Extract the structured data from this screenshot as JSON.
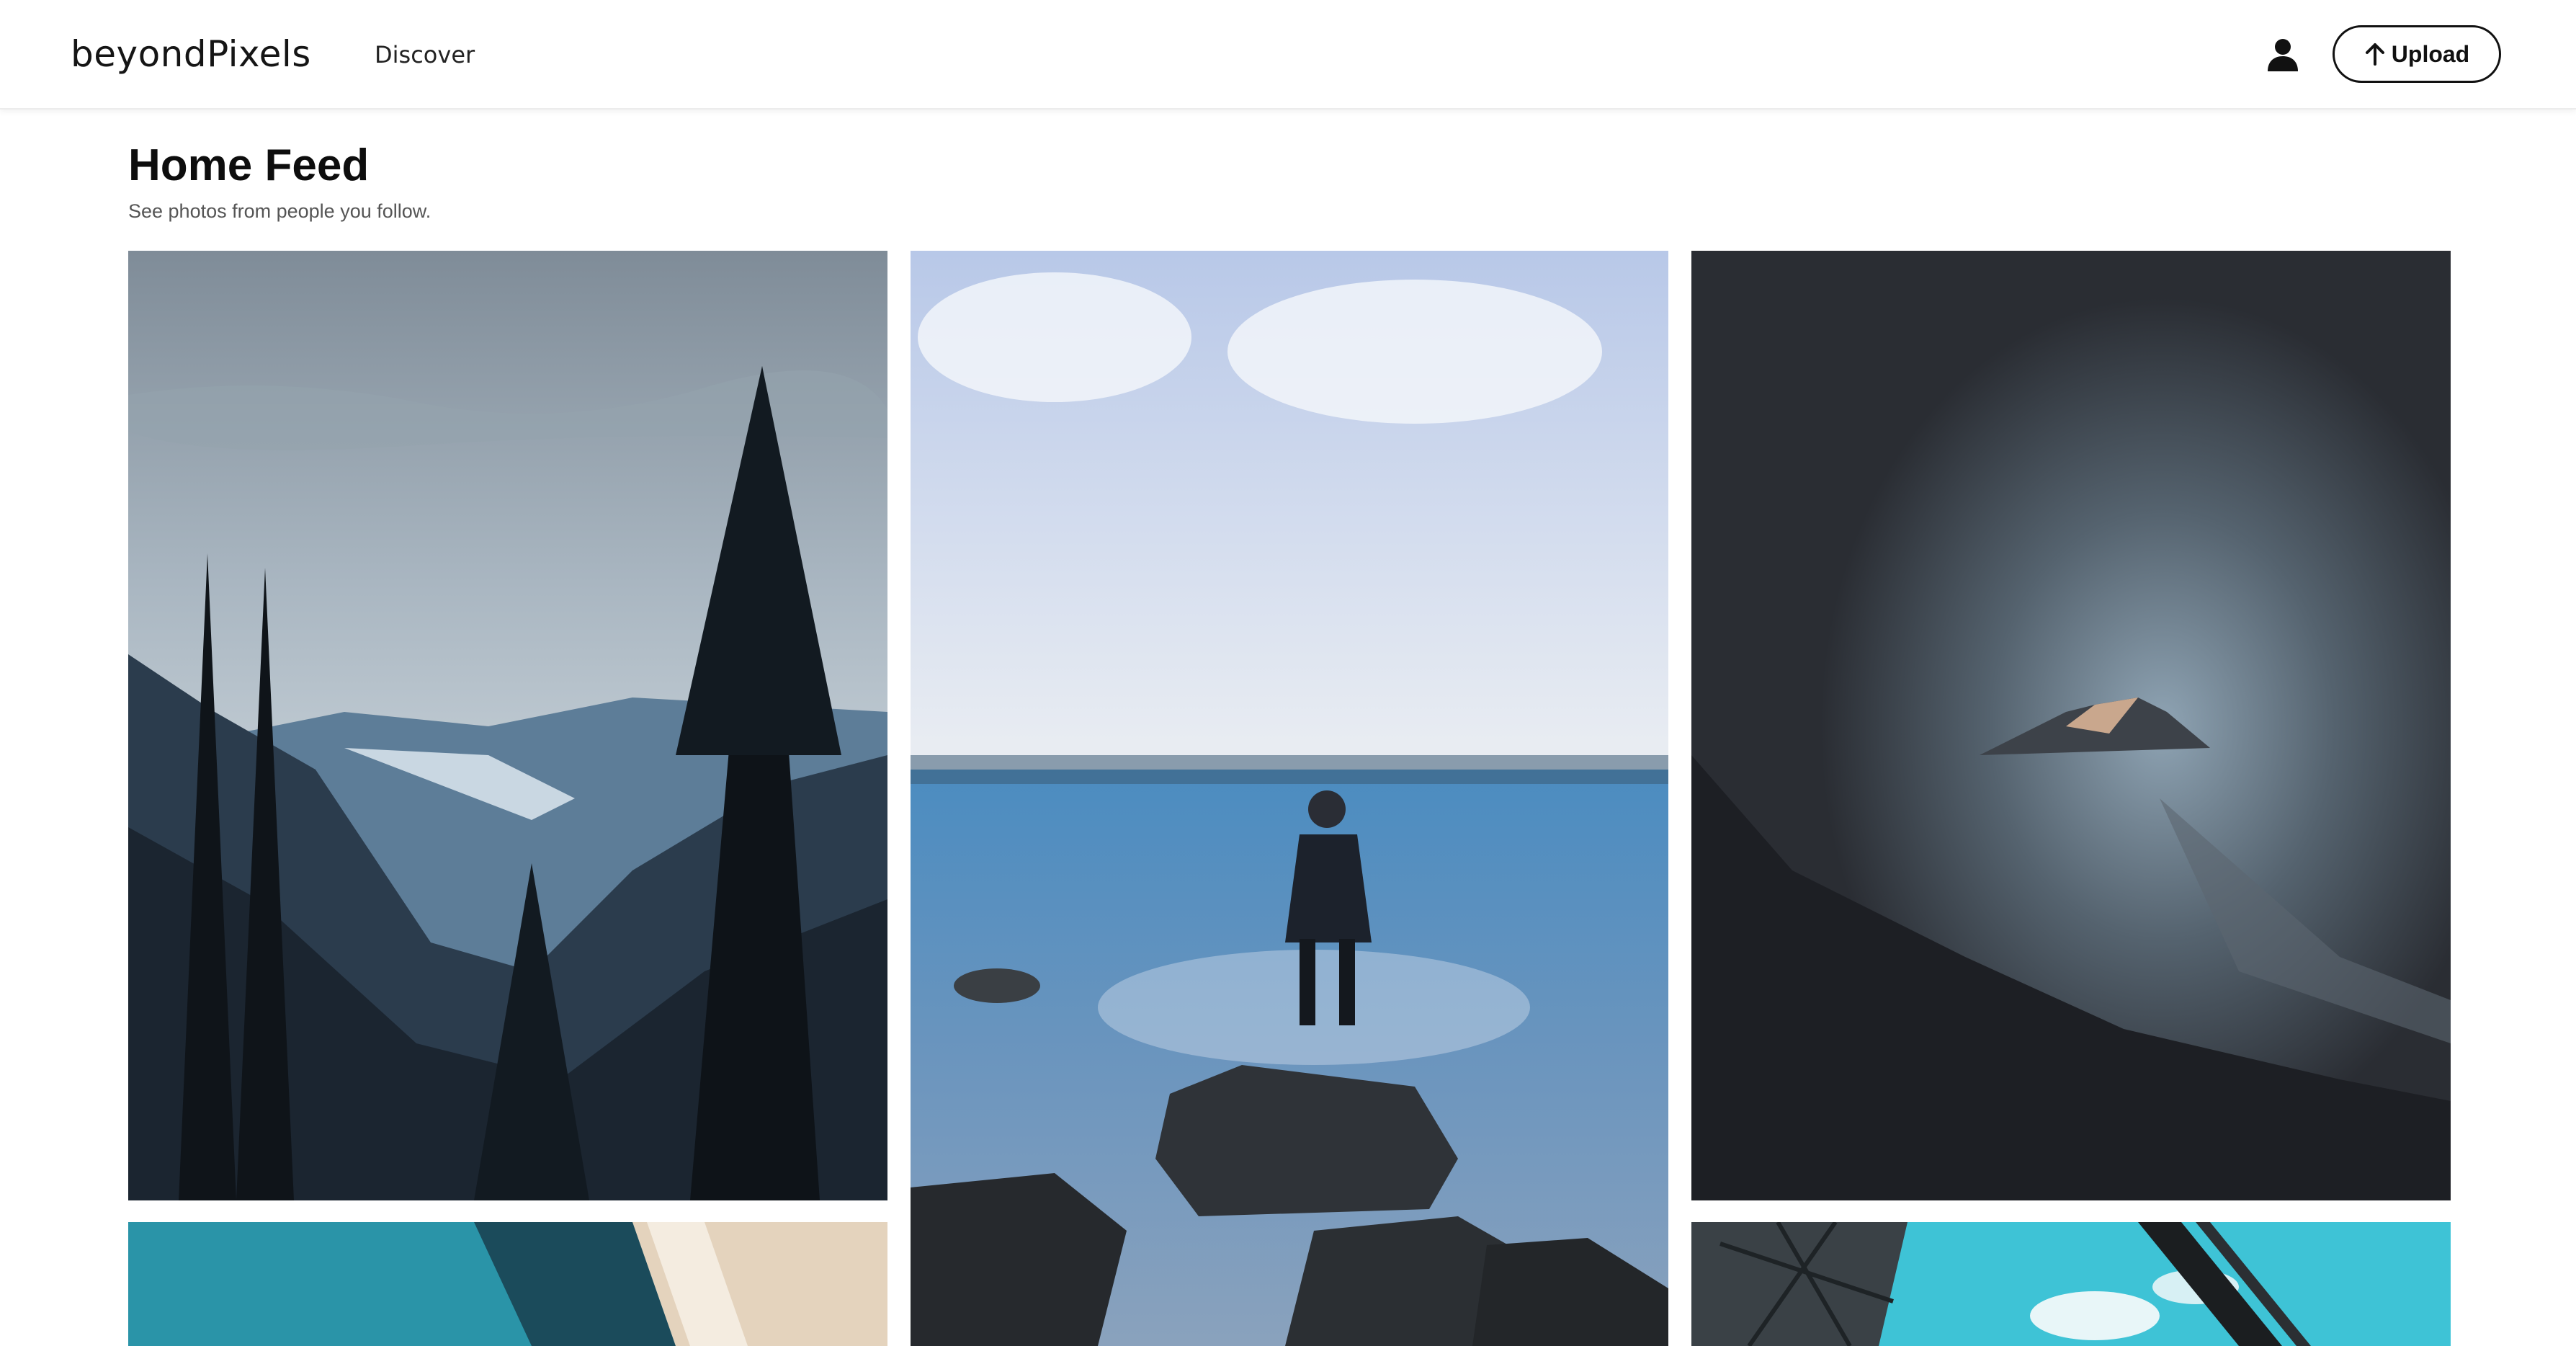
{
  "header": {
    "brand": "beyondPixels",
    "nav": {
      "discover": "Discover"
    },
    "profile_icon": "user-icon",
    "upload": {
      "label": "Upload",
      "icon": "arrow-up-icon"
    }
  },
  "main": {
    "title": "Home Feed",
    "subtitle": "See photos from people you follow."
  },
  "feed": {
    "photos": [
      {
        "subject": "forest-valley-lake"
      },
      {
        "subject": "person-standing-on-rock-by-misty-lake"
      },
      {
        "subject": "misty-dark-mountain-peak"
      },
      {
        "subject": "turquoise-sea-beach-aerial"
      },
      {
        "subject": "sky-with-metal-structures"
      }
    ]
  },
  "colors": {
    "accent": "#111111",
    "background": "#ffffff",
    "subtitle_text": "#555555"
  }
}
